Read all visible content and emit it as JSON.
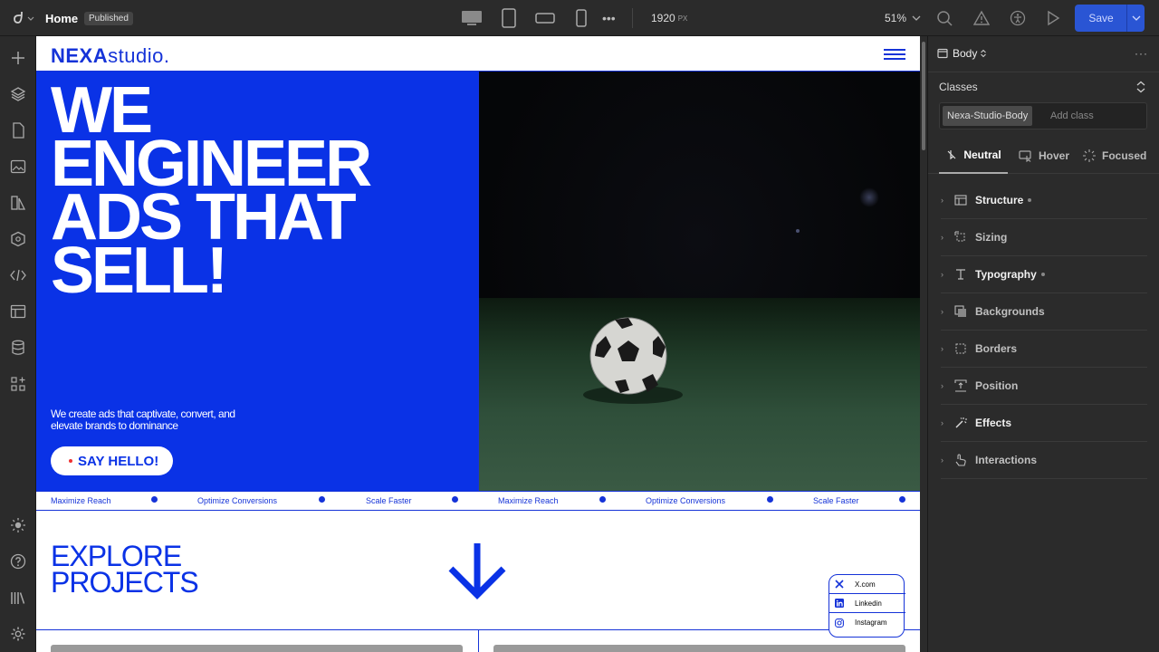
{
  "topbar": {
    "page_name": "Home",
    "status_badge": "Published",
    "width_value": "1920",
    "width_unit": "PX",
    "zoom": "51%",
    "save_label": "Save"
  },
  "page": {
    "logo_bold": "NEXA",
    "logo_rest": "studio.",
    "hero_lines": [
      "WE",
      "ENGINEER",
      "ADS THAT",
      "SELL!"
    ],
    "hero_sub": "We create ads that captivate, convert, and elevate brands to dominance",
    "cta": "SAY HELLO!",
    "ticker": [
      "Maximize Reach",
      "Optimize Conversions",
      "Scale Faster",
      "Maximize Reach",
      "Optimize Conversions",
      "Scale Faster"
    ],
    "explore_lines": [
      "EXPLORE",
      "PROJECTS"
    ],
    "social": [
      {
        "label": "X.com",
        "icon": "x-icon"
      },
      {
        "label": "Linkedin",
        "icon": "linkedin-icon"
      },
      {
        "label": "Instagram",
        "icon": "instagram-icon"
      }
    ]
  },
  "panel": {
    "element": "Body",
    "classes_title": "Classes",
    "class_chip": "Nexa-Studio-Body",
    "add_class": "Add class",
    "states": [
      "Neutral",
      "Hover",
      "Focused"
    ],
    "sections": [
      {
        "label": "Structure",
        "dot": true,
        "active": true
      },
      {
        "label": "Sizing",
        "dot": false,
        "active": false
      },
      {
        "label": "Typography",
        "dot": true,
        "active": true
      },
      {
        "label": "Backgrounds",
        "dot": false,
        "active": false
      },
      {
        "label": "Borders",
        "dot": false,
        "active": false
      },
      {
        "label": "Position",
        "dot": false,
        "active": false
      },
      {
        "label": "Effects",
        "dot": false,
        "active": true
      },
      {
        "label": "Interactions",
        "dot": false,
        "active": false
      }
    ]
  },
  "colors": {
    "brand_blue": "#0a32e6",
    "save_blue": "#2a55d4",
    "panel_bg": "#2b2b2b"
  }
}
